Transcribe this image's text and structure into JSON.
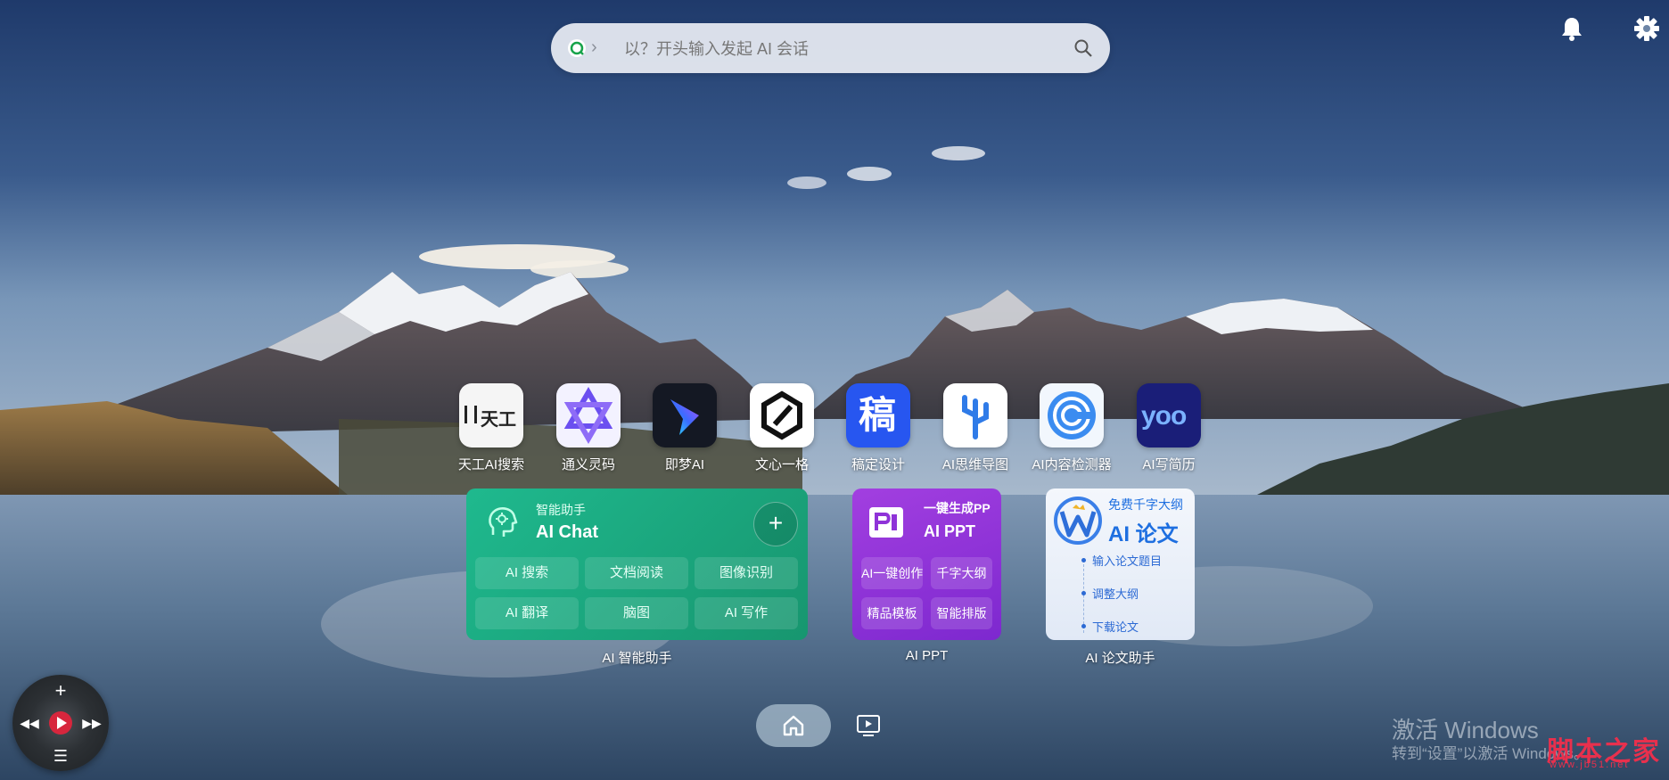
{
  "search": {
    "placeholder": "以？开头输入发起 AI 会话"
  },
  "apps": [
    {
      "label": "天工AI搜索",
      "tile_text": "天工"
    },
    {
      "label": "通义灵码"
    },
    {
      "label": "即梦AI"
    },
    {
      "label": "文心一格"
    },
    {
      "label": "稿定设计",
      "tile_text": "稿"
    },
    {
      "label": "AI思维导图"
    },
    {
      "label": "AI内容检测器"
    },
    {
      "label": "AI写简历",
      "tile_text": "yoo"
    }
  ],
  "chat_card": {
    "kicker": "智能助手",
    "title": "AI Chat",
    "plus": "+",
    "buttons": [
      "AI 搜索",
      "文档阅读",
      "图像识别",
      "AI 翻译",
      "脑图",
      "AI 写作"
    ],
    "caption": "AI 智能助手"
  },
  "ppt_card": {
    "kicker": "一键生成PP",
    "title": "AI PPT",
    "buttons": [
      "AI一键创作",
      "千字大纲",
      "精品模板",
      "智能排版"
    ],
    "caption": "AI PPT"
  },
  "paper_card": {
    "kicker": "免费千字大纲",
    "title": "AI 论文",
    "steps": [
      "输入论文题目",
      "调整大纲",
      "下载论文"
    ],
    "caption": "AI 论文助手"
  },
  "watermark": {
    "line1": "激活 Windows",
    "line2": "转到“设置”以激活 Windows。"
  },
  "site_mark": {
    "name": "脚本之家",
    "url": "www.jb51.net"
  },
  "colors": {
    "chat_green": "#1fb98e",
    "ppt_purple": "#8f33d8",
    "paper_blue": "#1e6fe0",
    "site_red": "#e8304d"
  },
  "icons": {
    "search_engine": "search-engine-icon",
    "search": "magnifier-icon",
    "notifications": "bell-icon",
    "settings": "gear-icon",
    "home": "home-icon",
    "media": "media-icon"
  }
}
